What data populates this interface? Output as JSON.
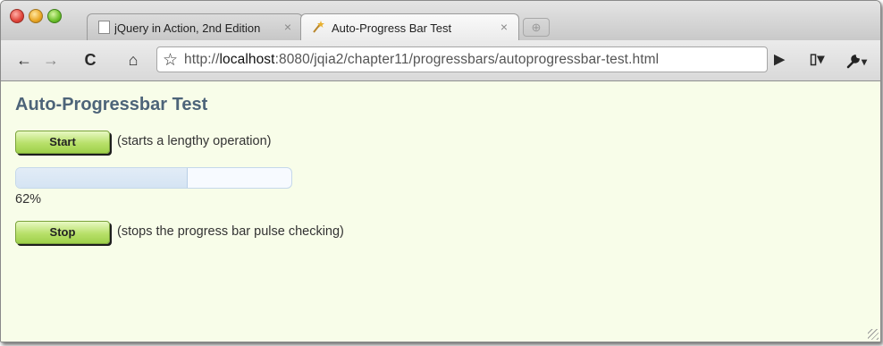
{
  "browser": {
    "tabs": [
      {
        "title": "jQuery in Action, 2nd Edition",
        "close": "×",
        "active": false
      },
      {
        "title": "Auto-Progress Bar Test",
        "close": "×",
        "active": true
      }
    ],
    "new_tab_icon": "new-tab-icon",
    "toolbar": {
      "back": "←",
      "forward": "→",
      "reload": "C",
      "home": "⌂",
      "bookmark_star": "☆",
      "url_prefix": "http://",
      "url_host": "localhost",
      "url_rest": ":8080/jqia2/chapter11/progressbars/autoprogressbar-test.html",
      "go": "▶",
      "page_menu": "▯▾",
      "tools_menu": "▾"
    }
  },
  "page": {
    "title": "Auto-Progressbar Test",
    "start_button": "Start",
    "start_desc": "(starts a lengthy operation)",
    "progress_value": 62,
    "progress_text": "62%",
    "stop_button": "Stop",
    "stop_desc": "(stops the progress bar pulse checking)"
  },
  "colors": {
    "page_background": "#f8fde9",
    "heading": "#4d6479",
    "button_green": "#b8e06a",
    "progress_fill": "#dbe8f5"
  }
}
